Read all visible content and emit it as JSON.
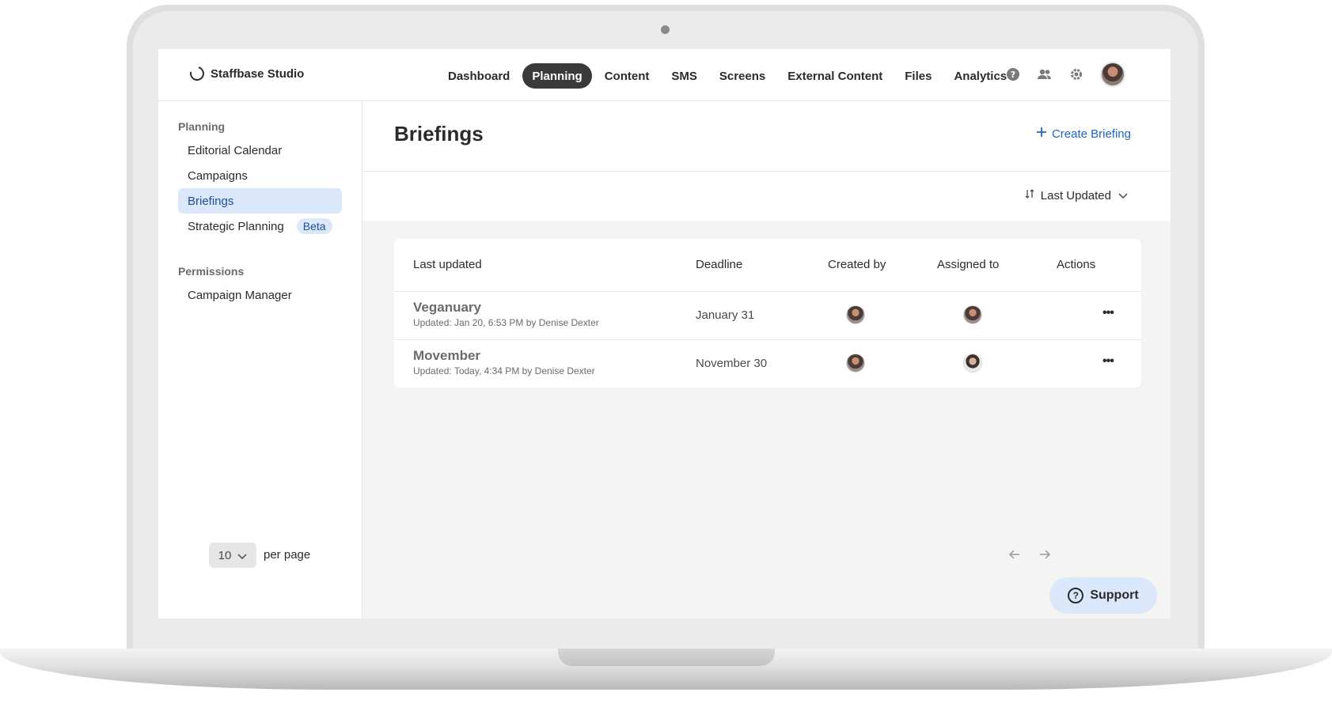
{
  "app": {
    "brand": "Staffbase Studio"
  },
  "nav": {
    "items": [
      {
        "label": "Dashboard"
      },
      {
        "label": "Planning"
      },
      {
        "label": "Content"
      },
      {
        "label": "SMS"
      },
      {
        "label": "Screens"
      },
      {
        "label": "External Content"
      },
      {
        "label": "Files"
      },
      {
        "label": "Analytics"
      }
    ],
    "active": "Planning"
  },
  "top_icons": [
    "help-icon",
    "people-icon",
    "gear-icon",
    "avatar"
  ],
  "sidebar": {
    "planning_heading": "Planning",
    "items": [
      {
        "label": "Editorial Calendar"
      },
      {
        "label": "Campaigns"
      },
      {
        "label": "Briefings"
      },
      {
        "label": "Strategic Planning",
        "badge": "Beta"
      }
    ],
    "permissions_heading": "Permissions",
    "permission_items": [
      {
        "label": "Campaign Manager"
      }
    ]
  },
  "main": {
    "title": "Briefings",
    "create_label": "Create Briefing",
    "sort_label": "Last Updated"
  },
  "table": {
    "headers": {
      "last_updated": "Last updated",
      "deadline": "Deadline",
      "created_by": "Created by",
      "assigned_to": "Assigned to",
      "actions": "Actions"
    },
    "rows": [
      {
        "title": "Veganuary",
        "subtitle": "Updated: Jan 20, 6:53 PM by Denise Dexter",
        "deadline": "January 31",
        "actions": "•••"
      },
      {
        "title": "Movember",
        "subtitle": "Updated: Today, 4:34 PM by Denise Dexter",
        "deadline": "November 30",
        "actions": "•••"
      }
    ]
  },
  "footer": {
    "per_page_value": "10",
    "per_page_label": "per page",
    "support_label": "Support"
  },
  "colors": {
    "accent": "#1f65c4",
    "active_nav_bg": "#3a3a3a",
    "sidebar_active_bg": "#dbe8fb"
  }
}
